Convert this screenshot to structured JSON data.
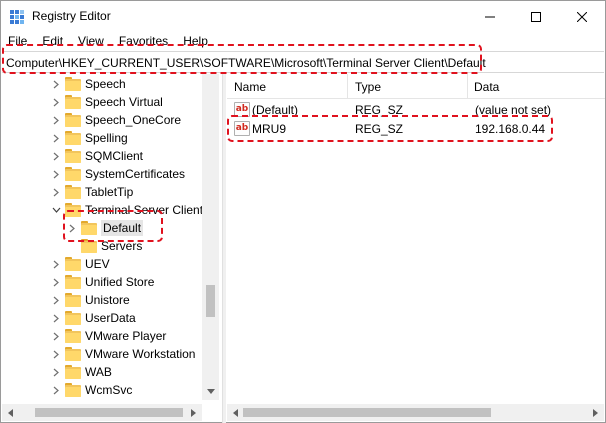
{
  "window": {
    "title": "Registry Editor"
  },
  "menu": [
    "File",
    "Edit",
    "View",
    "Favorites",
    "Help"
  ],
  "address": {
    "path": "Computer\\HKEY_CURRENT_USER\\SOFTWARE\\Microsoft\\Terminal Server Client\\Default"
  },
  "tree": {
    "items": [
      {
        "label": "Speech",
        "expander": "collapsed"
      },
      {
        "label": "Speech Virtual",
        "expander": "collapsed"
      },
      {
        "label": "Speech_OneCore",
        "expander": "collapsed"
      },
      {
        "label": "Spelling",
        "expander": "collapsed"
      },
      {
        "label": "SQMClient",
        "expander": "collapsed"
      },
      {
        "label": "SystemCertificates",
        "expander": "collapsed"
      },
      {
        "label": "TabletTip",
        "expander": "collapsed"
      },
      {
        "label": "Terminal Server Client",
        "expander": "expanded"
      },
      {
        "label": "Default",
        "expander": "collapsed",
        "selected": true
      },
      {
        "label": "Servers",
        "expander": "none"
      },
      {
        "label": "UEV",
        "expander": "collapsed"
      },
      {
        "label": "Unified Store",
        "expander": "collapsed"
      },
      {
        "label": "Unistore",
        "expander": "collapsed"
      },
      {
        "label": "UserData",
        "expander": "collapsed"
      },
      {
        "label": "VMware Player",
        "expander": "collapsed"
      },
      {
        "label": "VMware Workstation",
        "expander": "collapsed"
      },
      {
        "label": "WAB",
        "expander": "collapsed"
      },
      {
        "label": "WcmSvc",
        "expander": "collapsed"
      }
    ]
  },
  "list": {
    "columns": [
      "Name",
      "Type",
      "Data"
    ],
    "rows": [
      {
        "name": "(Default)",
        "type": "REG_SZ",
        "data": "(value not set)",
        "icon": "string-value-icon"
      },
      {
        "name": "MRU9",
        "type": "REG_SZ",
        "data": "192.168.0.44",
        "icon": "string-value-icon"
      }
    ]
  },
  "icons": {
    "value_icon_text": "ab"
  },
  "colors": {
    "highlight": "#e0121e",
    "folder": "#ffd86a",
    "selection": "#e5e5e5"
  }
}
